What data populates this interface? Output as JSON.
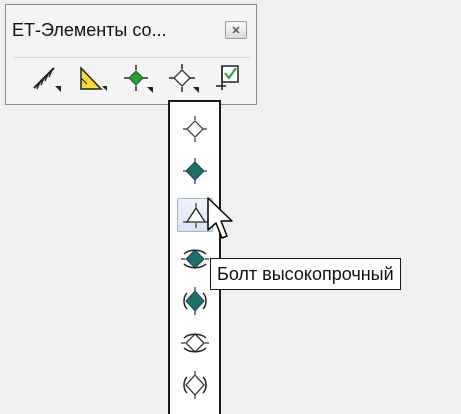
{
  "toolbar": {
    "title": "ЕТ-Элементы со...",
    "close_icon": "close-icon",
    "tools": [
      {
        "name": "weld-seam-icon"
      },
      {
        "name": "angle-dimension-icon"
      },
      {
        "name": "cross-marker-icon"
      },
      {
        "name": "diamond-marker-icon"
      },
      {
        "name": "checkbox-marker-icon"
      }
    ]
  },
  "flyout": {
    "items": [
      {
        "name": "open-diamond-icon"
      },
      {
        "name": "filled-diamond-icon"
      },
      {
        "name": "triangle-icon",
        "state": "hover"
      },
      {
        "name": "bolt-hidden-icon"
      },
      {
        "name": "bolt-filled-icon"
      },
      {
        "name": "bolt-open-icon"
      },
      {
        "name": "bolt-outline-icon"
      }
    ]
  },
  "tooltip": {
    "text": "Болт высокопрочный"
  },
  "colors": {
    "accent": "#1f6f6a",
    "tool_yellow": "#f5dc3b",
    "marker_green": "#2e9c3a"
  }
}
